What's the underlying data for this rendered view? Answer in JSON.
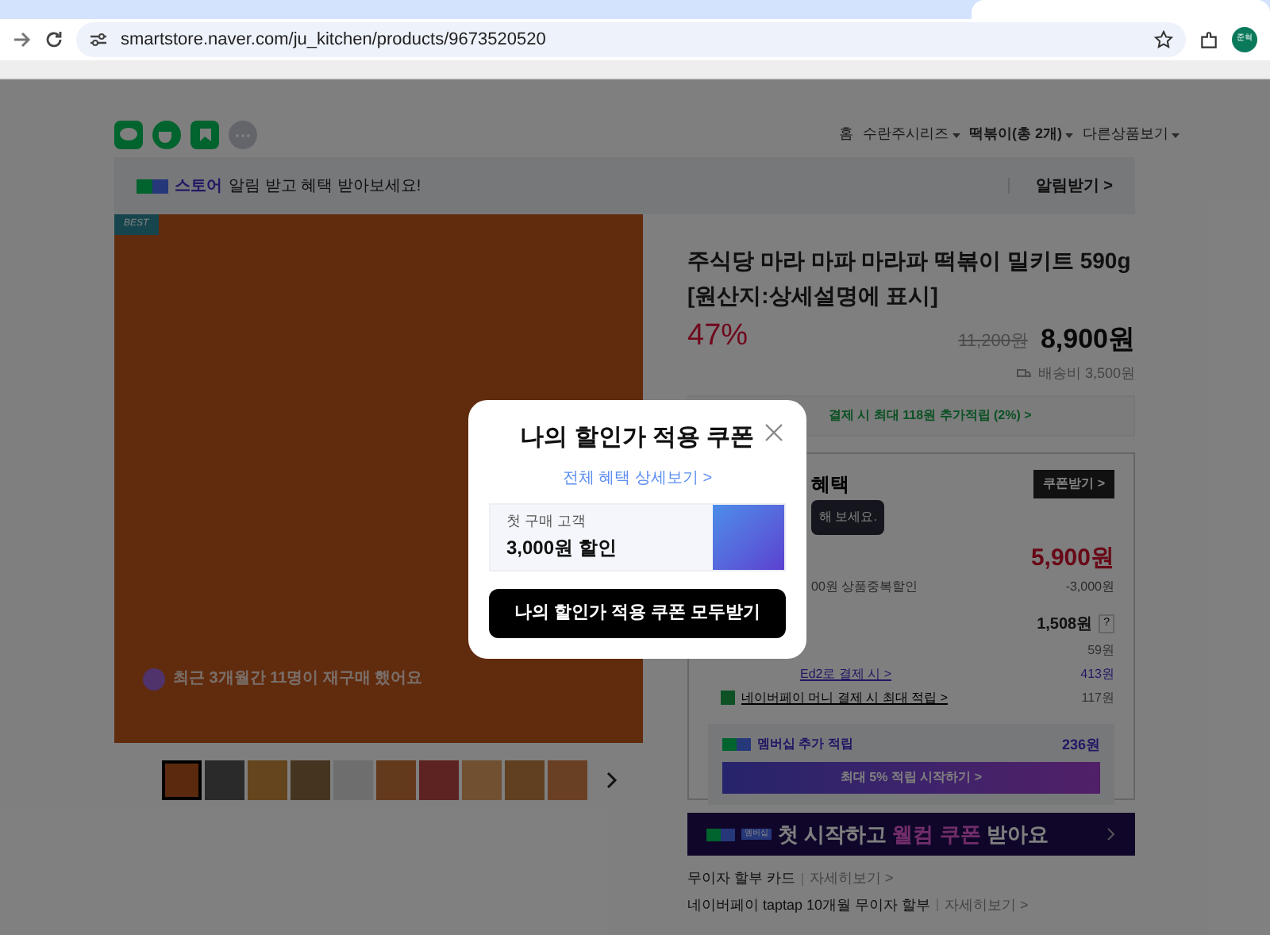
{
  "browser": {
    "url": "smartstore.naver.com/ju_kitchen/products/9673520520",
    "profile": "준혁"
  },
  "breadcrumb": [
    {
      "label": "홈"
    },
    {
      "label": "수란주시리즈",
      "dropdown": true
    },
    {
      "label": "떡볶이(총 2개)",
      "dropdown": true
    },
    {
      "label": "다른상품보기",
      "dropdown": true
    }
  ],
  "notice": {
    "brand": "스토어",
    "text": "알림 받고 혜택 받아보세요!",
    "action": "알림받기 >"
  },
  "gallery": {
    "badge": "BEST",
    "repurchase": "최근 3개월간 11명이 재구매 했어요",
    "thumbnails": [
      {
        "selected": true
      },
      {
        "selected": false
      },
      {
        "selected": false
      },
      {
        "selected": false
      },
      {
        "selected": false
      },
      {
        "selected": false
      },
      {
        "selected": false
      },
      {
        "selected": false
      },
      {
        "selected": false
      },
      {
        "selected": false
      }
    ]
  },
  "product": {
    "title": "주식당 마라 마파 마라파 떡볶이 밀키트 590g [원산지:상세설명에 표시]",
    "discount": "47%",
    "original_price": "11,200원",
    "price": "8,900원",
    "shipping": "배송비 3,500원"
  },
  "points_banner": "결제 시 최대 118원 추가적립 (2%) >",
  "benefits": {
    "title": "혜택",
    "coupon_button": "쿠폰받기 >",
    "tooltip": "해 보세요.",
    "final_price": "5,900원",
    "discount_label": "00원 상품중복할인",
    "discount_value": "-3,000원",
    "points_total": "1,508원",
    "help": "?",
    "rows": [
      {
        "label": "",
        "value": "59원"
      },
      {
        "label": "Ed2로 결제 시 >",
        "value": "413원"
      },
      {
        "label": "네이버페이 머니 결제 시 최대 적립 >",
        "value": "117원"
      }
    ]
  },
  "membership": {
    "label": "멤버십 추가 적립",
    "value": "236원",
    "button": "최대 5% 적립 시작하기 >"
  },
  "welcome_banner": {
    "tag": "멤버십",
    "text_before": "첫 시작하고",
    "highlight": "웰컴 쿠폰",
    "text_after": "받아요"
  },
  "installments": [
    {
      "label": "무이자 할부 카드",
      "link": "자세히보기 >"
    },
    {
      "label": "네이버페이 taptap 10개월 무이자 할부",
      "link": "자세히보기 >"
    }
  ],
  "modal": {
    "title": "나의 할인가 적용 쿠폰",
    "details_link": "전체 혜택 상세보기 >",
    "coupons": [
      {
        "caption": "첫 구매 고객",
        "amount": "3,000원 할인"
      }
    ],
    "download_all": "나의 할인가 적용 쿠폰 모두받기"
  }
}
